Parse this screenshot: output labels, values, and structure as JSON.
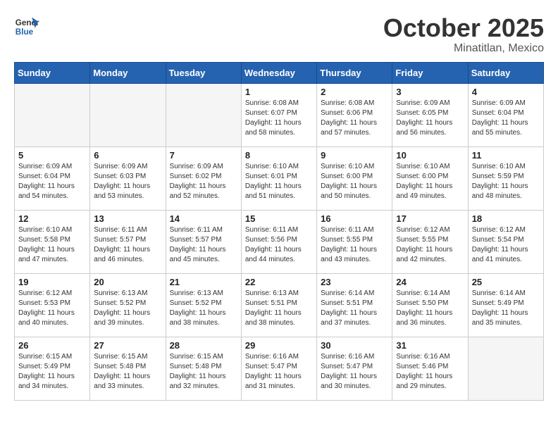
{
  "header": {
    "logo_general": "General",
    "logo_blue": "Blue",
    "month": "October 2025",
    "location": "Minatitlan, Mexico"
  },
  "days_of_week": [
    "Sunday",
    "Monday",
    "Tuesday",
    "Wednesday",
    "Thursday",
    "Friday",
    "Saturday"
  ],
  "weeks": [
    [
      {
        "num": "",
        "info": ""
      },
      {
        "num": "",
        "info": ""
      },
      {
        "num": "",
        "info": ""
      },
      {
        "num": "1",
        "info": "Sunrise: 6:08 AM\nSunset: 6:07 PM\nDaylight: 11 hours\nand 58 minutes."
      },
      {
        "num": "2",
        "info": "Sunrise: 6:08 AM\nSunset: 6:06 PM\nDaylight: 11 hours\nand 57 minutes."
      },
      {
        "num": "3",
        "info": "Sunrise: 6:09 AM\nSunset: 6:05 PM\nDaylight: 11 hours\nand 56 minutes."
      },
      {
        "num": "4",
        "info": "Sunrise: 6:09 AM\nSunset: 6:04 PM\nDaylight: 11 hours\nand 55 minutes."
      }
    ],
    [
      {
        "num": "5",
        "info": "Sunrise: 6:09 AM\nSunset: 6:04 PM\nDaylight: 11 hours\nand 54 minutes."
      },
      {
        "num": "6",
        "info": "Sunrise: 6:09 AM\nSunset: 6:03 PM\nDaylight: 11 hours\nand 53 minutes."
      },
      {
        "num": "7",
        "info": "Sunrise: 6:09 AM\nSunset: 6:02 PM\nDaylight: 11 hours\nand 52 minutes."
      },
      {
        "num": "8",
        "info": "Sunrise: 6:10 AM\nSunset: 6:01 PM\nDaylight: 11 hours\nand 51 minutes."
      },
      {
        "num": "9",
        "info": "Sunrise: 6:10 AM\nSunset: 6:00 PM\nDaylight: 11 hours\nand 50 minutes."
      },
      {
        "num": "10",
        "info": "Sunrise: 6:10 AM\nSunset: 6:00 PM\nDaylight: 11 hours\nand 49 minutes."
      },
      {
        "num": "11",
        "info": "Sunrise: 6:10 AM\nSunset: 5:59 PM\nDaylight: 11 hours\nand 48 minutes."
      }
    ],
    [
      {
        "num": "12",
        "info": "Sunrise: 6:10 AM\nSunset: 5:58 PM\nDaylight: 11 hours\nand 47 minutes."
      },
      {
        "num": "13",
        "info": "Sunrise: 6:11 AM\nSunset: 5:57 PM\nDaylight: 11 hours\nand 46 minutes."
      },
      {
        "num": "14",
        "info": "Sunrise: 6:11 AM\nSunset: 5:57 PM\nDaylight: 11 hours\nand 45 minutes."
      },
      {
        "num": "15",
        "info": "Sunrise: 6:11 AM\nSunset: 5:56 PM\nDaylight: 11 hours\nand 44 minutes."
      },
      {
        "num": "16",
        "info": "Sunrise: 6:11 AM\nSunset: 5:55 PM\nDaylight: 11 hours\nand 43 minutes."
      },
      {
        "num": "17",
        "info": "Sunrise: 6:12 AM\nSunset: 5:55 PM\nDaylight: 11 hours\nand 42 minutes."
      },
      {
        "num": "18",
        "info": "Sunrise: 6:12 AM\nSunset: 5:54 PM\nDaylight: 11 hours\nand 41 minutes."
      }
    ],
    [
      {
        "num": "19",
        "info": "Sunrise: 6:12 AM\nSunset: 5:53 PM\nDaylight: 11 hours\nand 40 minutes."
      },
      {
        "num": "20",
        "info": "Sunrise: 6:13 AM\nSunset: 5:52 PM\nDaylight: 11 hours\nand 39 minutes."
      },
      {
        "num": "21",
        "info": "Sunrise: 6:13 AM\nSunset: 5:52 PM\nDaylight: 11 hours\nand 38 minutes."
      },
      {
        "num": "22",
        "info": "Sunrise: 6:13 AM\nSunset: 5:51 PM\nDaylight: 11 hours\nand 38 minutes."
      },
      {
        "num": "23",
        "info": "Sunrise: 6:14 AM\nSunset: 5:51 PM\nDaylight: 11 hours\nand 37 minutes."
      },
      {
        "num": "24",
        "info": "Sunrise: 6:14 AM\nSunset: 5:50 PM\nDaylight: 11 hours\nand 36 minutes."
      },
      {
        "num": "25",
        "info": "Sunrise: 6:14 AM\nSunset: 5:49 PM\nDaylight: 11 hours\nand 35 minutes."
      }
    ],
    [
      {
        "num": "26",
        "info": "Sunrise: 6:15 AM\nSunset: 5:49 PM\nDaylight: 11 hours\nand 34 minutes."
      },
      {
        "num": "27",
        "info": "Sunrise: 6:15 AM\nSunset: 5:48 PM\nDaylight: 11 hours\nand 33 minutes."
      },
      {
        "num": "28",
        "info": "Sunrise: 6:15 AM\nSunset: 5:48 PM\nDaylight: 11 hours\nand 32 minutes."
      },
      {
        "num": "29",
        "info": "Sunrise: 6:16 AM\nSunset: 5:47 PM\nDaylight: 11 hours\nand 31 minutes."
      },
      {
        "num": "30",
        "info": "Sunrise: 6:16 AM\nSunset: 5:47 PM\nDaylight: 11 hours\nand 30 minutes."
      },
      {
        "num": "31",
        "info": "Sunrise: 6:16 AM\nSunset: 5:46 PM\nDaylight: 11 hours\nand 29 minutes."
      },
      {
        "num": "",
        "info": ""
      }
    ]
  ]
}
